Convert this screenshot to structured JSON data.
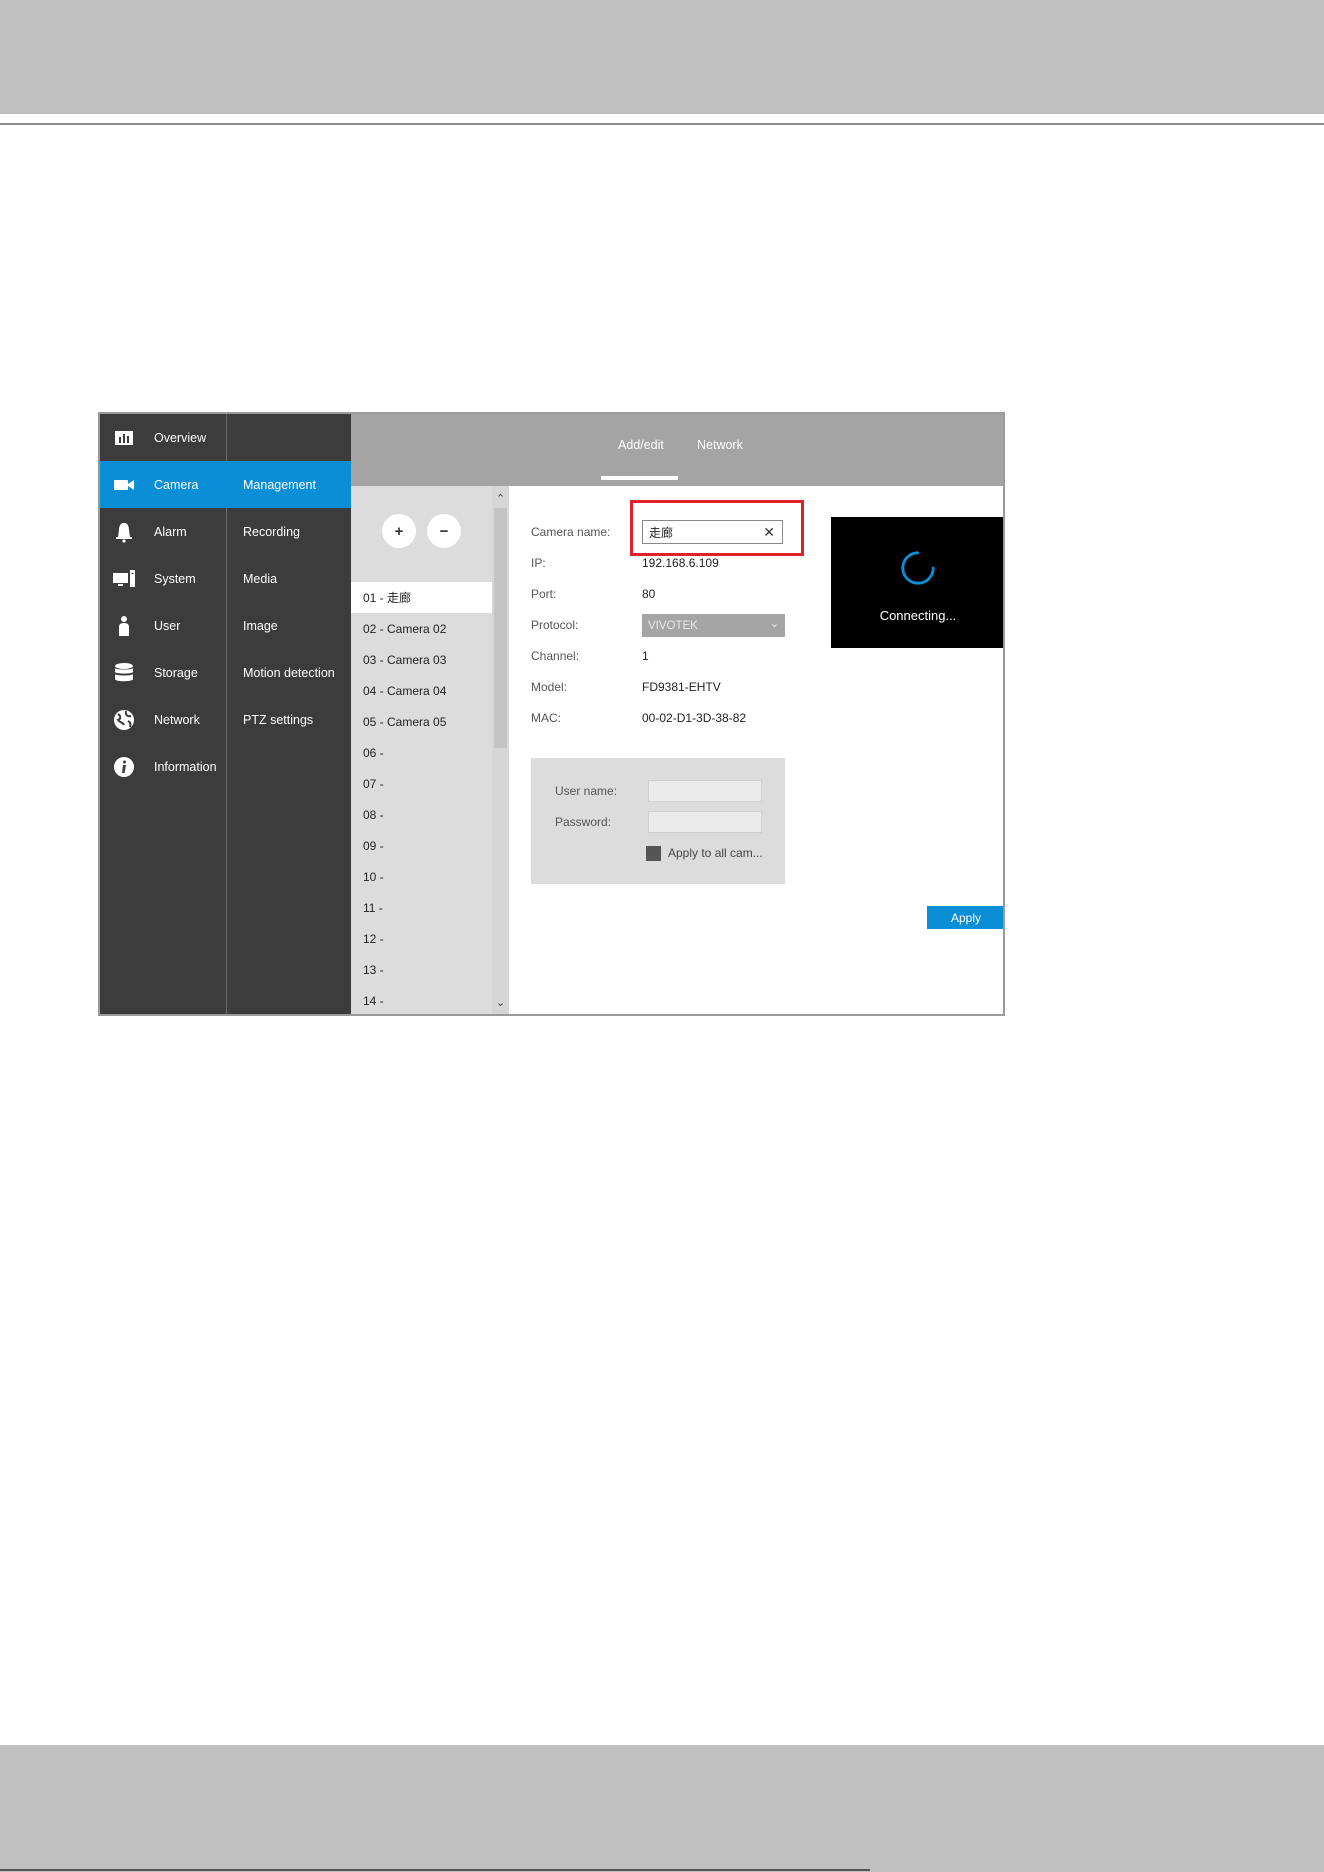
{
  "sidebar": {
    "items": [
      {
        "label": "Overview",
        "icon": "overview-chart-icon"
      },
      {
        "label": "Camera",
        "icon": "camera-icon",
        "active": true
      },
      {
        "label": "Alarm",
        "icon": "bell-icon"
      },
      {
        "label": "System",
        "icon": "system-computer-icon"
      },
      {
        "label": "User",
        "icon": "user-icon"
      },
      {
        "label": "Storage",
        "icon": "storage-database-icon"
      },
      {
        "label": "Network",
        "icon": "network-globe-icon"
      },
      {
        "label": "Information",
        "icon": "information-icon"
      }
    ]
  },
  "submenu": {
    "items": [
      {
        "label": "Management",
        "active": true
      },
      {
        "label": "Recording"
      },
      {
        "label": "Media"
      },
      {
        "label": "Image"
      },
      {
        "label": "Motion detection"
      },
      {
        "label": "PTZ settings"
      }
    ]
  },
  "tabs": [
    {
      "label": "Add/edit",
      "active": true
    },
    {
      "label": "Network"
    }
  ],
  "camera_list": {
    "add_label": "+",
    "remove_label": "−",
    "rows": [
      "01 - 走廊",
      "02 - Camera 02",
      "03 - Camera 03",
      "04 - Camera 04",
      "05 - Camera 05",
      "06 -",
      "07 -",
      "08 -",
      "09 -",
      "10 -",
      "11 -",
      "12 -",
      "13 -",
      "14 -"
    ],
    "selected_index": 0
  },
  "form": {
    "camera_name_label": "Camera name:",
    "camera_name_value": "走廊",
    "clear_glyph": "✕",
    "ip_label": "IP:",
    "ip_value": "192.168.6.109",
    "port_label": "Port:",
    "port_value": "80",
    "protocol_label": "Protocol:",
    "protocol_value": "VIVOTEK",
    "channel_label": "Channel:",
    "channel_value": "1",
    "model_label": "Model:",
    "model_value": "FD9381-EHTV",
    "mac_label": "MAC:",
    "mac_value": "00-02-D1-3D-38-82"
  },
  "credentials": {
    "username_label": "User name:",
    "password_label": "Password:",
    "apply_all_label": "Apply to all cam..."
  },
  "preview": {
    "status": "Connecting..."
  },
  "apply_label": "Apply",
  "colors": {
    "accent": "#0a8ed6",
    "nav_background": "#3c3c3c",
    "highlight_box": "#e0202a",
    "page_band": "#bfc0bf"
  }
}
